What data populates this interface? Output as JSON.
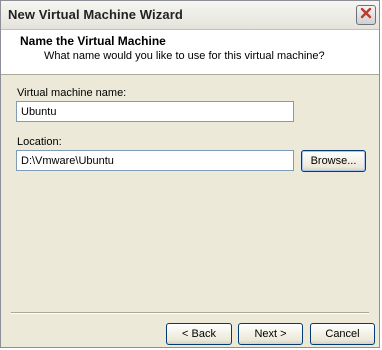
{
  "window": {
    "title": "New Virtual Machine Wizard",
    "close_icon": "close-icon",
    "close_color": "#c0392b"
  },
  "header": {
    "title": "Name the Virtual Machine",
    "subtitle": "What name would you like to use for this virtual machine?"
  },
  "form": {
    "name_label": "Virtual machine name:",
    "name_value": "Ubuntu",
    "location_label": "Location:",
    "location_value": "D:\\Vmware\\Ubuntu",
    "browse_label": "Browse..."
  },
  "footer": {
    "back_label": "< Back",
    "next_label": "Next >",
    "cancel_label": "Cancel"
  }
}
